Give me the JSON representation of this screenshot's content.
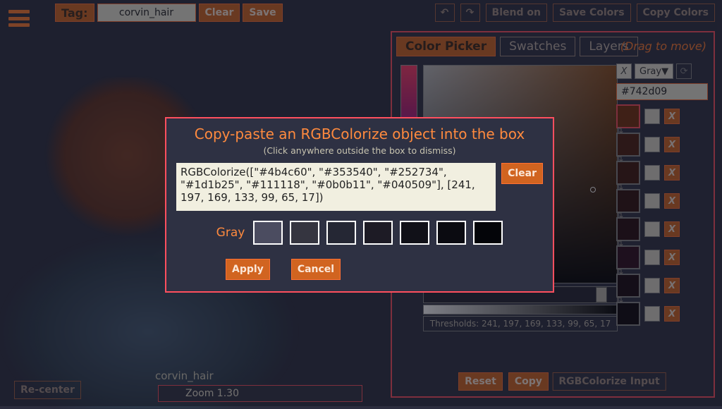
{
  "top": {
    "tag_label": "Tag:",
    "tag_value": "corvin_hair",
    "clear": "Clear",
    "save": "Save",
    "undo_icon": "↶",
    "redo_icon": "↷",
    "blend": "Blend on",
    "save_colors": "Save Colors",
    "copy_colors": "Copy Colors"
  },
  "panel": {
    "tabs": [
      "Color Picker",
      "Swatches",
      "Layers"
    ],
    "active_tab": 0,
    "drag_hint": "(Drag to move)",
    "hex": "#742d09",
    "gray_pill": "Gray▼",
    "x_label": "X",
    "thresholds_label": "Thresholds: 241, 197, 169, 133, 99, 65, 17",
    "reset": "Reset",
    "copy": "Copy",
    "rgb_input": "RGBColorize Input",
    "swatches": [
      {
        "color": "#742d09",
        "border": "#ff4f5e"
      },
      {
        "color": "#4a1c0c",
        "border": "#888"
      },
      {
        "color": "#3c150b",
        "border": "#888"
      },
      {
        "color": "#2d0e0a",
        "border": "#888"
      },
      {
        "color": "#240a0c",
        "border": "#888"
      },
      {
        "color": "#2a0b1a",
        "border": "#888"
      },
      {
        "color": "#15060d",
        "border": "#888"
      },
      {
        "color": "#0b0408",
        "border": "#888"
      }
    ]
  },
  "bottom": {
    "recenter": "Re-center",
    "label": "corvin_hair",
    "zoom": "Zoom 1.30"
  },
  "modal": {
    "title": "Copy-paste an RGBColorize object into the box",
    "hint": "(Click anywhere outside the box to dismiss)",
    "text": "RGBColorize([\"#4b4c60\", \"#353540\", \"#252734\", \"#1d1b25\", \"#111118\", \"#0b0b11\", \"#040509\"], [241, 197, 169, 133, 99, 65, 17])",
    "clear": "Clear",
    "row_label": "Gray",
    "apply": "Apply",
    "cancel": "Cancel",
    "swatches": [
      "#4b4c60",
      "#353540",
      "#252734",
      "#1d1b25",
      "#111118",
      "#0b0b11",
      "#040509"
    ]
  }
}
